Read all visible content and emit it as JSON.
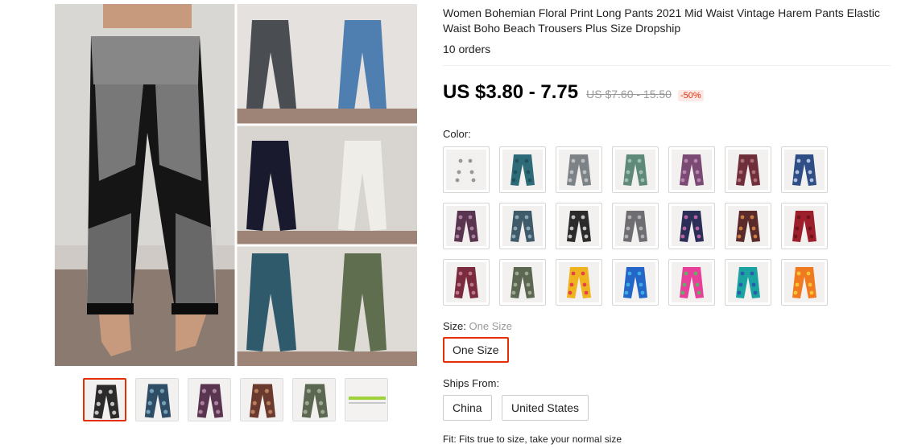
{
  "product": {
    "title": "Women Bohemian Floral Print Long Pants 2021 Mid Waist Vintage Harem Pants Elastic Waist Boho Beach Trousers Plus Size Dropship",
    "orders": "10 orders",
    "price": "US $3.80 - 7.75",
    "original_price": "US $7.60 - 15.50",
    "discount": "-50%"
  },
  "color": {
    "label": "Color:",
    "swatches": [
      {
        "name": "white-paisley",
        "fill": "#f2f0ee",
        "pattern": "#888"
      },
      {
        "name": "teal-solid",
        "fill": "#2d6b78",
        "pattern": "#1f4e58"
      },
      {
        "name": "grey-paisley",
        "fill": "#7d8286",
        "pattern": "#c9c9c9"
      },
      {
        "name": "green-mandala",
        "fill": "#5f8a7a",
        "pattern": "#a9c8b8"
      },
      {
        "name": "purple-paisley",
        "fill": "#7b4a74",
        "pattern": "#c28fb5"
      },
      {
        "name": "maroon-paisley",
        "fill": "#6f2f3a",
        "pattern": "#b97b84"
      },
      {
        "name": "blue-tribal",
        "fill": "#2f4e86",
        "pattern": "#c9d6ee"
      },
      {
        "name": "plum-print",
        "fill": "#5a3550",
        "pattern": "#b98fae"
      },
      {
        "name": "blue-grey-print",
        "fill": "#3f5b6a",
        "pattern": "#9cb4c1"
      },
      {
        "name": "black-white-print",
        "fill": "#2b2b2b",
        "pattern": "#dddddd"
      },
      {
        "name": "grey-floral",
        "fill": "#6e6e72",
        "pattern": "#bcbcc0"
      },
      {
        "name": "navy-peacock",
        "fill": "#2b2f58",
        "pattern": "#d06bb0"
      },
      {
        "name": "brown-peacock",
        "fill": "#5b2b2b",
        "pattern": "#d98b4a"
      },
      {
        "name": "red-solid",
        "fill": "#9d1f2b",
        "pattern": "#6c1019"
      },
      {
        "name": "wine-print",
        "fill": "#7a2b3d",
        "pattern": "#c98599"
      },
      {
        "name": "olive-print",
        "fill": "#5c6752",
        "pattern": "#a9b39c"
      },
      {
        "name": "rainbow-tiedye",
        "fill": "#f0b320",
        "pattern": "#e0304a"
      },
      {
        "name": "blue-tiedye",
        "fill": "#2466c8",
        "pattern": "#43b8e8"
      },
      {
        "name": "pink-tiedye",
        "fill": "#e8409a",
        "pattern": "#50c060"
      },
      {
        "name": "teal-tiedye",
        "fill": "#1aa3a0",
        "pattern": "#2c4fb0"
      },
      {
        "name": "orange-tiedye",
        "fill": "#f07a20",
        "pattern": "#f3d43a"
      }
    ]
  },
  "size": {
    "label": "Size:",
    "selected_text": "One Size",
    "options": [
      "One Size"
    ]
  },
  "ships_from": {
    "label": "Ships From:",
    "options": [
      "China",
      "United States"
    ]
  },
  "fit": {
    "text": "Fit: Fits true to size, take your normal size"
  },
  "gallery": {
    "thumbnails": [
      {
        "name": "thumb-black-white-pants",
        "fill": "#2b2b2b",
        "pattern": "#dddddd"
      },
      {
        "name": "thumb-blue-mandala-pants",
        "fill": "#2f4e66",
        "pattern": "#7eb0c8"
      },
      {
        "name": "thumb-plum-pants",
        "fill": "#5a3550",
        "pattern": "#b98fae"
      },
      {
        "name": "thumb-brown-pants",
        "fill": "#6b3a2e",
        "pattern": "#c68a62"
      },
      {
        "name": "thumb-olive-pants",
        "fill": "#5c6752",
        "pattern": "#a9b39c"
      },
      {
        "name": "thumb-size-chart",
        "fill": "#ffffff",
        "pattern": "#9ed13a"
      }
    ]
  }
}
